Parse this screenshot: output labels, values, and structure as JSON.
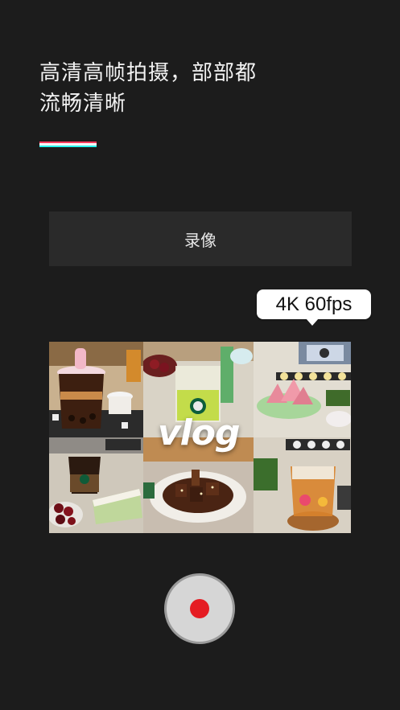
{
  "headline": {
    "line1": "高清高帧拍摄，部部都",
    "line2": "流畅清晰"
  },
  "accent_colors": {
    "top": "#ff3b5c",
    "middle": "#f7f7f7",
    "bottom": "#25f4ee"
  },
  "mode_button": {
    "label": "录像"
  },
  "badge": {
    "text": "4K 60fps"
  },
  "collage": {
    "overlay_text": "vlog",
    "tiles": [
      {
        "icon": "bubble-tea-photo"
      },
      {
        "icon": "green-drink-photo"
      },
      {
        "icon": "sushi-plate-photo"
      },
      {
        "icon": "cake-cherries-photo"
      },
      {
        "icon": "ribs-plate-photo"
      },
      {
        "icon": "iced-tea-photo"
      }
    ]
  },
  "record_button": {
    "icon": "record-dot-icon",
    "color": "#e51c23"
  }
}
